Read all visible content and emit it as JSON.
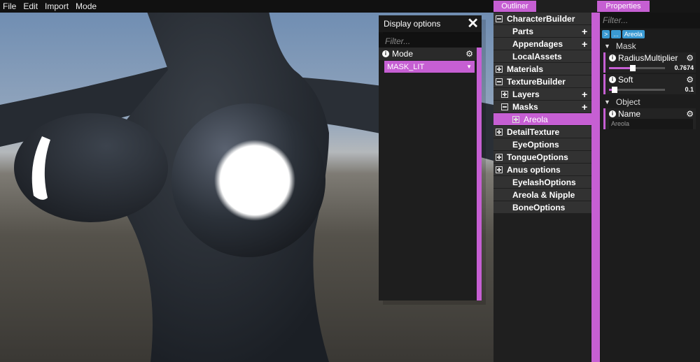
{
  "menu": [
    "File",
    "Edit",
    "Import",
    "Mode"
  ],
  "display_options": {
    "title": "Display options",
    "filter_placeholder": "Filter...",
    "mode_label": "Mode",
    "mode_value": "MASK_LIT"
  },
  "outliner": {
    "tab": "Outliner",
    "nodes": [
      {
        "label": "CharacterBuilder",
        "level": 0,
        "toggle": "minus",
        "add": false,
        "selected": false
      },
      {
        "label": "Parts",
        "level": 1,
        "toggle": "none",
        "add": true,
        "selected": false
      },
      {
        "label": "Appendages",
        "level": 1,
        "toggle": "none",
        "add": true,
        "selected": false
      },
      {
        "label": "LocalAssets",
        "level": 1,
        "toggle": "none",
        "add": false,
        "selected": false
      },
      {
        "label": "Materials",
        "level": 0,
        "toggle": "plus",
        "add": false,
        "selected": false
      },
      {
        "label": "TextureBuilder",
        "level": 0,
        "toggle": "minus",
        "add": false,
        "selected": false
      },
      {
        "label": "Layers",
        "level": 1,
        "toggle": "plus",
        "add": true,
        "selected": false
      },
      {
        "label": "Masks",
        "level": 1,
        "toggle": "minus",
        "add": true,
        "selected": false
      },
      {
        "label": "Areola",
        "level": 2,
        "toggle": "plus",
        "add": false,
        "selected": true
      },
      {
        "label": "DetailTexture",
        "level": 0,
        "toggle": "plus",
        "add": false,
        "selected": false
      },
      {
        "label": "EyeOptions",
        "level": 1,
        "toggle": "none",
        "add": false,
        "selected": false
      },
      {
        "label": "TongueOptions",
        "level": 0,
        "toggle": "plus",
        "add": false,
        "selected": false
      },
      {
        "label": "Anus options",
        "level": 0,
        "toggle": "plus",
        "add": false,
        "selected": false
      },
      {
        "label": "EyelashOptions",
        "level": 1,
        "toggle": "none",
        "add": false,
        "selected": false
      },
      {
        "label": "Areola & Nipple",
        "level": 1,
        "toggle": "none",
        "add": false,
        "selected": false
      },
      {
        "label": "BoneOptions",
        "level": 1,
        "toggle": "none",
        "add": false,
        "selected": false
      }
    ]
  },
  "properties": {
    "tab": "Properties",
    "filter_placeholder": "Filter...",
    "breadcrumb": [
      ">",
      "...",
      "Areola"
    ],
    "mask_section": "Mask",
    "radius": {
      "label": "RadiusMultiplier",
      "value": "0.7674",
      "fraction": 0.42
    },
    "soft": {
      "label": "Soft",
      "value": "0.1",
      "fraction": 0.1
    },
    "object_section": "Object",
    "name": {
      "label": "Name",
      "value": "Areola"
    }
  },
  "colors": {
    "accent": "#c65fd3",
    "crumb": "#3a9ad3"
  }
}
